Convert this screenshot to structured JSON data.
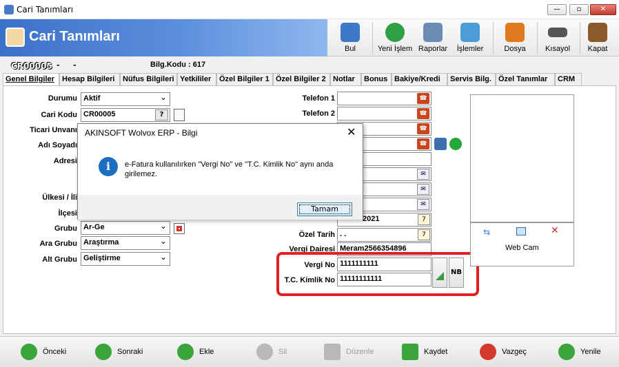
{
  "window": {
    "title": "Cari Tanımları",
    "minimize": "—",
    "maximize": "▫",
    "close": "✕"
  },
  "header": {
    "title": "Cari Tanımları"
  },
  "toolbar": [
    {
      "label": "Bul",
      "color": "#3d79c8"
    },
    {
      "label": "Yeni İşlem",
      "color": "#2ea043"
    },
    {
      "label": "Raporlar",
      "color": "#6b8bb5"
    },
    {
      "label": "İşlemler",
      "color": "#4c9cd6"
    },
    {
      "label": "Dosya",
      "color": "#e07a1e"
    },
    {
      "label": "Kısayol",
      "color": "#555555"
    },
    {
      "label": "Kapat",
      "color": "#8a5a2a"
    }
  ],
  "info": {
    "code": "CR00005",
    "dash1": "-",
    "dash2": "-",
    "bilg_kodu": "Bilg.Kodu : 617"
  },
  "tabs": [
    "Genel Bilgiler",
    "Hesap Bilgileri",
    "Nüfus Bilgileri",
    "Yetkililer",
    "Özel Bilgiler 1",
    "Özel Bilgiler 2",
    "Notlar",
    "Bonus",
    "Bakiye/Kredi",
    "Servis Bilg.",
    "Özel Tanımlar",
    "CRM"
  ],
  "left_form": {
    "durumu_label": "Durumu",
    "durumu_value": "Aktif",
    "cari_kodu_label": "Cari Kodu",
    "cari_kodu_value": "CR00005",
    "cari_kodu_btn": "?",
    "ticari_unvani_label": "Ticari Unvanı",
    "adi_soyadi_label": "Adı Soyadı",
    "adresi_label": "Adresi",
    "ulkesi_label": "Ülkesi / İli",
    "ilcesi_label": "İlçesi",
    "grubu_label": "Grubu",
    "grubu_value": "Ar-Ge",
    "ara_grubu_label": "Ara Grubu",
    "ara_grubu_value": "Araştırma",
    "alt_grubu_label": "Alt Grubu",
    "alt_grubu_value": "Geliştirme"
  },
  "right_form": {
    "telefon1_label": "Telefon 1",
    "telefon2_label": "Telefon 2",
    "date_value": "2021",
    "ozel_tarih_label": "Özel Tarih",
    "ozel_tarih_value": ". .",
    "vergi_dairesi_label": "Vergi Dairesi",
    "vergi_dairesi_value": "Meram2566354896",
    "vergi_no_label": "Vergi No",
    "vergi_no_value": "1111111111",
    "tc_label": "T.C. Kimlik No",
    "tc_value": "11111111111",
    "nb_label": "NB"
  },
  "photo": {
    "webcam_label": "Web Cam"
  },
  "dialog": {
    "title": "AKINSOFT Wolvox ERP - Bilgi",
    "close": "✕",
    "icon": "i",
    "message": "e-Fatura kullanılırken \"Vergi No\" ve \"T.C. Kimlik No\" aynı anda girilemez.",
    "ok": "Tamam"
  },
  "bottom": [
    {
      "label": "Önceki",
      "color": "#3aa53a",
      "disabled": false
    },
    {
      "label": "Sonraki",
      "color": "#3aa53a",
      "disabled": false
    },
    {
      "label": "Ekle",
      "color": "#3aa53a",
      "disabled": false
    },
    {
      "label": "Sil",
      "color": "#b8b8b8",
      "disabled": true
    },
    {
      "label": "Düzenle",
      "color": "#b8b8b8",
      "disabled": true
    },
    {
      "label": "Kaydet",
      "color": "#3aa53a",
      "disabled": false
    },
    {
      "label": "Vazgeç",
      "color": "#d33a2c",
      "disabled": false
    },
    {
      "label": "Yenile",
      "color": "#3aa53a",
      "disabled": false
    }
  ]
}
